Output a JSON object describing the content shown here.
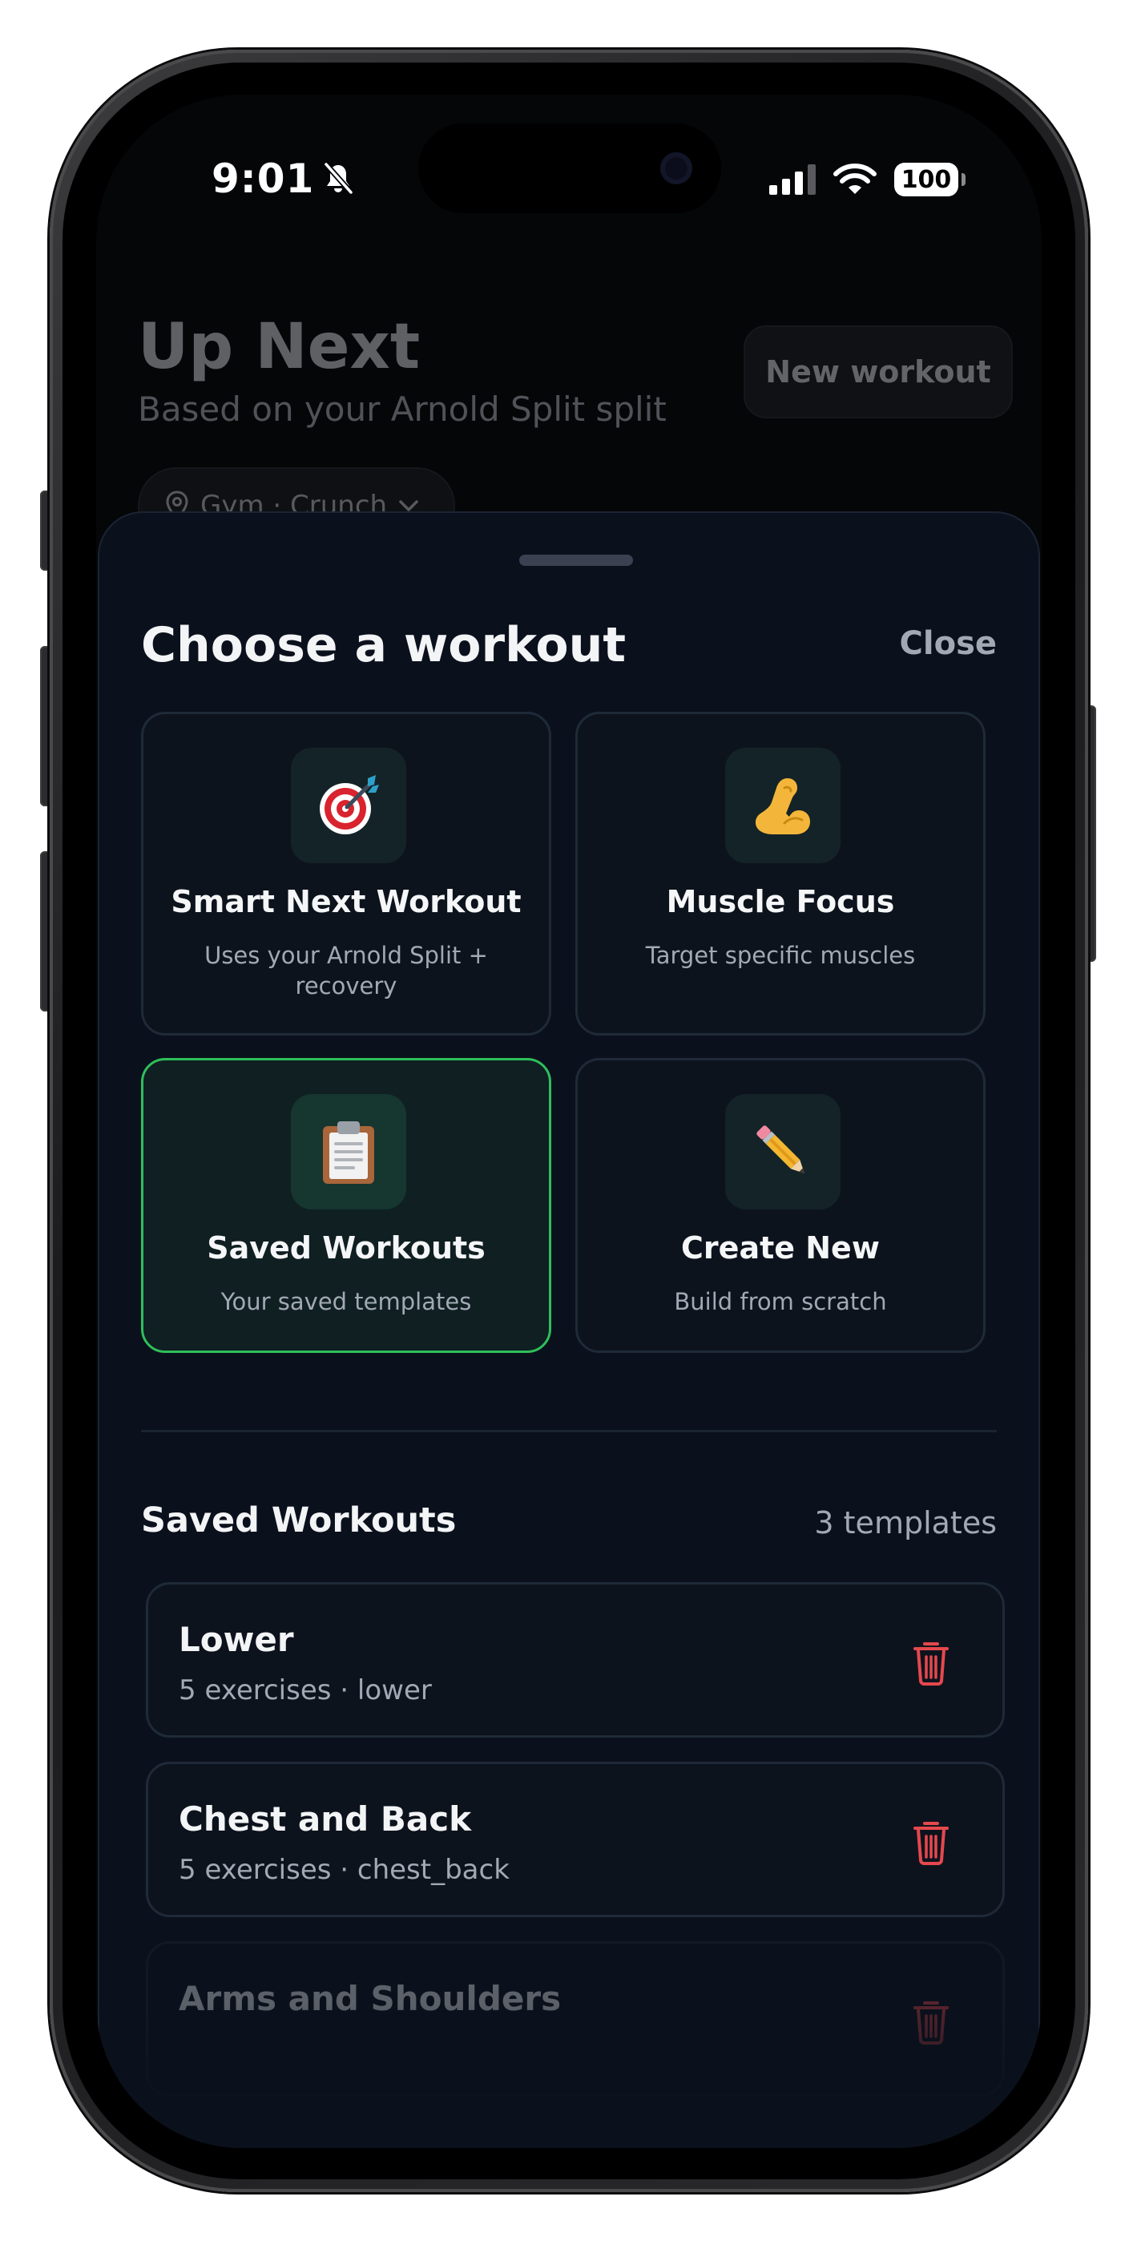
{
  "status_bar": {
    "time": "9:01",
    "battery": "100",
    "icons": [
      "bell-slash-icon",
      "cellular-signal-icon",
      "wifi-icon",
      "battery-icon"
    ]
  },
  "background": {
    "title": "Up Next",
    "subtitle": "Based on your Arnold Split split",
    "new_workout_label": "New workout",
    "gym_label": "Gym · Crunch"
  },
  "sheet": {
    "title": "Choose a workout",
    "close_label": "Close",
    "options": [
      {
        "title": "Smart Next Workout",
        "desc": "Uses your Arnold Split + recovery",
        "icon": "🎯",
        "icon_name": "target-icon",
        "selected": false
      },
      {
        "title": "Muscle Focus",
        "desc": "Target specific muscles",
        "icon": "💪",
        "icon_name": "flexed-biceps-icon",
        "selected": false
      },
      {
        "title": "Saved Workouts",
        "desc": "Your saved templates",
        "icon": "📋",
        "icon_name": "clipboard-icon",
        "selected": true
      },
      {
        "title": "Create New",
        "desc": "Build from scratch",
        "icon": "✏️",
        "icon_name": "pencil-icon",
        "selected": false
      }
    ],
    "saved_section": {
      "title": "Saved Workouts",
      "count": "3 templates",
      "templates": [
        {
          "name": "Lower",
          "meta": "5 exercises · lower"
        },
        {
          "name": "Chest and Back",
          "meta": "5 exercises · chest_back"
        },
        {
          "name": "Arms and Shoulders",
          "meta": ""
        }
      ]
    }
  },
  "colors": {
    "accent_green": "#2fbf5b",
    "delete_red": "#e5484d",
    "sheet_bg": "#0b111c"
  }
}
